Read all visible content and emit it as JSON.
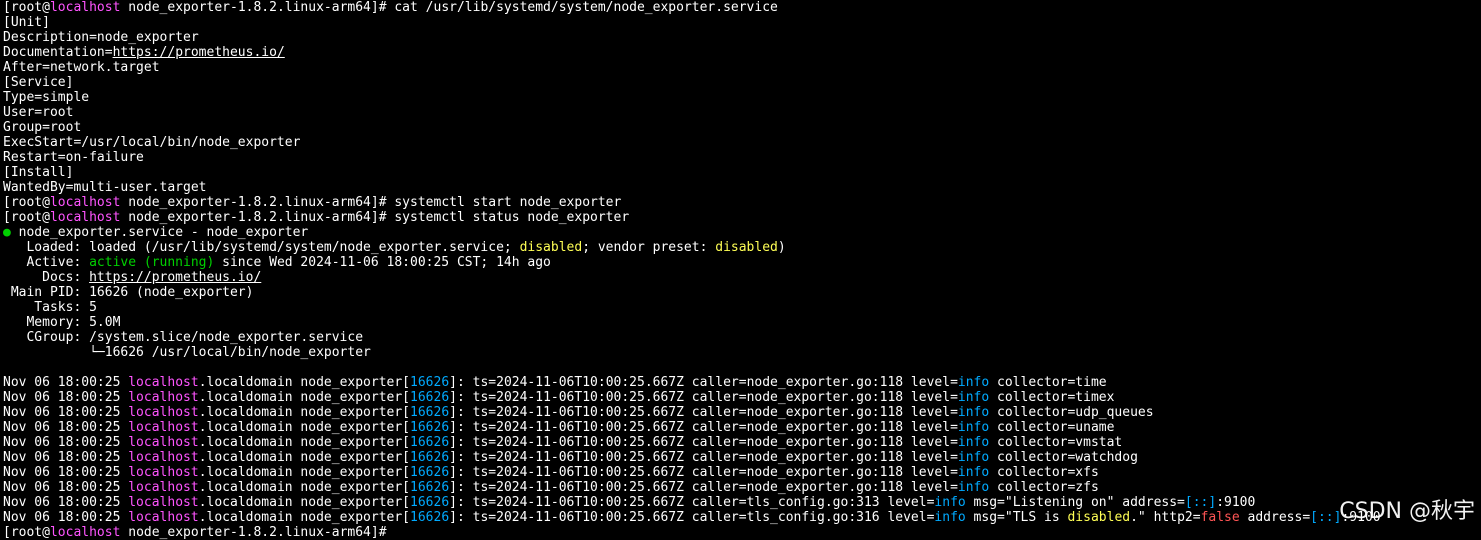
{
  "terminal": {
    "lines": [
      {
        "a": "[root@",
        "b": "localhost",
        "c": " node_exporter-1.8.2.linux-arm64]# cat /usr/lib/systemd/system/node_exporter.service"
      },
      {
        "a": "[Unit]"
      },
      {
        "a": "Description=node_exporter"
      },
      {
        "a": "Documentation=",
        "link": "https://prometheus.io/"
      },
      {
        "a": "After=network.target"
      },
      {
        "a": "[Service]"
      },
      {
        "a": "Type=simple"
      },
      {
        "a": "User=root"
      },
      {
        "a": "Group=root"
      },
      {
        "a": "ExecStart=/usr/local/bin/node_exporter"
      },
      {
        "a": "Restart=on-failure"
      },
      {
        "a": "[Install]"
      },
      {
        "a": "WantedBy=multi-user.target"
      },
      {
        "a": "[root@",
        "b": "localhost",
        "c": " node_exporter-1.8.2.linux-arm64]# systemctl start node_exporter"
      },
      {
        "a": "[root@",
        "b": "localhost",
        "c": " node_exporter-1.8.2.linux-arm64]# systemctl status node_exporter"
      },
      {
        "dot": "●",
        "a": " node_exporter.service - node_exporter"
      },
      {
        "a": "   Loaded: loaded (/usr/lib/systemd/system/node_exporter.service; ",
        "y1": "disabled",
        "a2": "; vendor preset: ",
        "y2": "disabled",
        "a3": ")"
      },
      {
        "a": "   Active: ",
        "g": "active (running)",
        "a2": " since Wed 2024-11-06 18:00:25 CST; 14h ago"
      },
      {
        "a": "     Docs: ",
        "link": "https://prometheus.io/"
      },
      {
        "a": " Main PID: 16626 (node_exporter)"
      },
      {
        "a": "    Tasks: 5"
      },
      {
        "a": "   Memory: 5.0M"
      },
      {
        "a": "   CGroup: /system.slice/node_exporter.service"
      },
      {
        "a": "           └─16626 /usr/local/bin/node_exporter"
      },
      {
        "a": ""
      }
    ],
    "logs": [
      {
        "pre": "Nov 06 18:00:25 ",
        "host": "localhost",
        "mid": ".localdomain node_exporter[",
        "pid": "16626",
        "post": "]: ts=2024-11-06T10:00:25.667Z caller=node_exporter.go:118 level=",
        "lvl": "info",
        "tail": " collector=time"
      },
      {
        "pre": "Nov 06 18:00:25 ",
        "host": "localhost",
        "mid": ".localdomain node_exporter[",
        "pid": "16626",
        "post": "]: ts=2024-11-06T10:00:25.667Z caller=node_exporter.go:118 level=",
        "lvl": "info",
        "tail": " collector=timex"
      },
      {
        "pre": "Nov 06 18:00:25 ",
        "host": "localhost",
        "mid": ".localdomain node_exporter[",
        "pid": "16626",
        "post": "]: ts=2024-11-06T10:00:25.667Z caller=node_exporter.go:118 level=",
        "lvl": "info",
        "tail": " collector=udp_queues"
      },
      {
        "pre": "Nov 06 18:00:25 ",
        "host": "localhost",
        "mid": ".localdomain node_exporter[",
        "pid": "16626",
        "post": "]: ts=2024-11-06T10:00:25.667Z caller=node_exporter.go:118 level=",
        "lvl": "info",
        "tail": " collector=uname"
      },
      {
        "pre": "Nov 06 18:00:25 ",
        "host": "localhost",
        "mid": ".localdomain node_exporter[",
        "pid": "16626",
        "post": "]: ts=2024-11-06T10:00:25.667Z caller=node_exporter.go:118 level=",
        "lvl": "info",
        "tail": " collector=vmstat"
      },
      {
        "pre": "Nov 06 18:00:25 ",
        "host": "localhost",
        "mid": ".localdomain node_exporter[",
        "pid": "16626",
        "post": "]: ts=2024-11-06T10:00:25.667Z caller=node_exporter.go:118 level=",
        "lvl": "info",
        "tail": " collector=watchdog"
      },
      {
        "pre": "Nov 06 18:00:25 ",
        "host": "localhost",
        "mid": ".localdomain node_exporter[",
        "pid": "16626",
        "post": "]: ts=2024-11-06T10:00:25.667Z caller=node_exporter.go:118 level=",
        "lvl": "info",
        "tail": " collector=xfs"
      },
      {
        "pre": "Nov 06 18:00:25 ",
        "host": "localhost",
        "mid": ".localdomain node_exporter[",
        "pid": "16626",
        "post": "]: ts=2024-11-06T10:00:25.667Z caller=node_exporter.go:118 level=",
        "lvl": "info",
        "tail": " collector=zfs"
      },
      {
        "pre": "Nov 06 18:00:25 ",
        "host": "localhost",
        "mid": ".localdomain node_exporter[",
        "pid": "16626",
        "post": "]: ts=2024-11-06T10:00:25.667Z caller=tls_config.go:313 level=",
        "lvl": "info",
        "tail": " msg=\"Listening on\" address=",
        "addr": "[::]",
        "tail2": ":9100"
      },
      {
        "pre": "Nov 06 18:00:25 ",
        "host": "localhost",
        "mid": ".localdomain node_exporter[",
        "pid": "16626",
        "post": "]: ts=2024-11-06T10:00:25.667Z caller=tls_config.go:316 level=",
        "lvl": "info",
        "tail": " msg=\"TLS is ",
        "y": "disabled",
        "tail3": ".\" http2=",
        "f": "false",
        "tail4": " address=",
        "addr": "[::]",
        "tail2": ":9100"
      }
    ],
    "prompt_last": {
      "a": "[root@",
      "b": "localhost",
      "c": " node_exporter-1.8.2.linux-arm64]#"
    }
  },
  "watermark": "CSDN @秋宇"
}
